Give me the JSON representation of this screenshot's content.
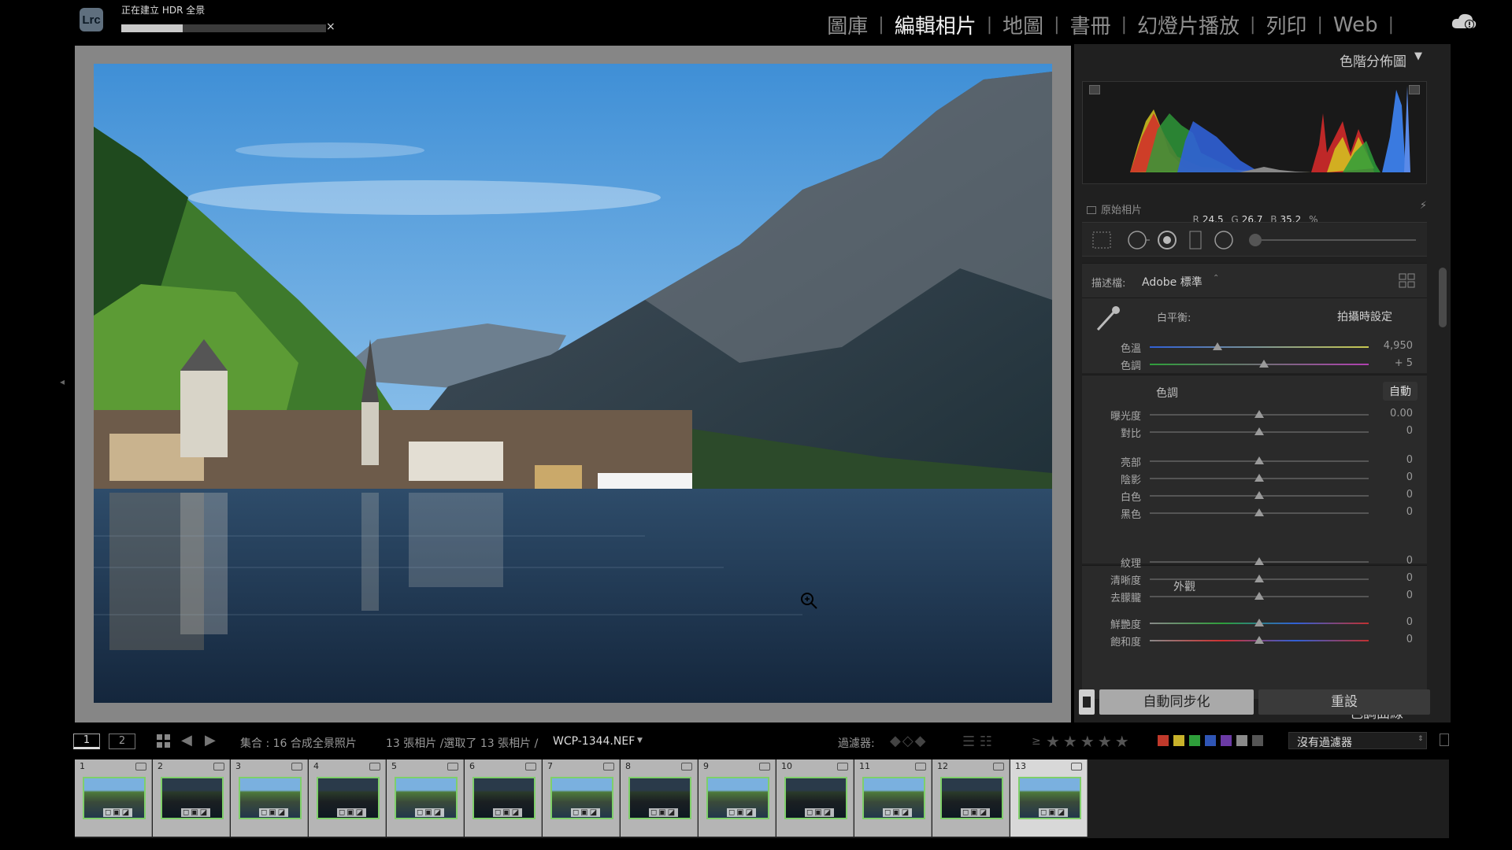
{
  "top": {
    "logo": "Lrc",
    "task_label": "正在建立 HDR 全景",
    "task_progress": 0.3,
    "task_close": "×",
    "modules": [
      {
        "label": "圖庫",
        "active": false
      },
      {
        "label": "編輯相片",
        "active": true
      },
      {
        "label": "地圖",
        "active": false
      },
      {
        "label": "書冊",
        "active": false
      },
      {
        "label": "幻燈片播放",
        "active": false
      },
      {
        "label": "列印",
        "active": false
      },
      {
        "label": "Web",
        "active": false
      }
    ],
    "separator": "|",
    "cloud_icon": "cloud-sync-icon"
  },
  "histogram": {
    "title": "色階分佈圖",
    "collapse": "▼",
    "r_label": "R",
    "r_value": "24.5",
    "g_label": "G",
    "g_value": "26.7",
    "b_label": "B",
    "b_value": "35.2",
    "percent": "%",
    "original_label": "原始相片"
  },
  "profile": {
    "label": "描述檔:",
    "value": "Adobe 標準",
    "arrow": "⌃"
  },
  "wb": {
    "label": "白平衡:",
    "value": "拍攝時設定",
    "temp_label": "色溫",
    "temp_value": "4,950",
    "temp_pos": 0.31,
    "tint_label": "色調",
    "tint_value": "+ 5",
    "tint_pos": 0.52
  },
  "tone": {
    "title": "色調",
    "auto": "自動",
    "sliders": [
      {
        "label": "曝光度",
        "value": "0.00",
        "pos": 0.5
      },
      {
        "label": "對比",
        "value": "0",
        "pos": 0.5
      },
      {
        "label": "亮部",
        "value": "0",
        "pos": 0.5
      },
      {
        "label": "陰影",
        "value": "0",
        "pos": 0.5
      },
      {
        "label": "白色",
        "value": "0",
        "pos": 0.5
      },
      {
        "label": "黑色",
        "value": "0",
        "pos": 0.5
      }
    ]
  },
  "presence": {
    "title": "外觀",
    "sliders": [
      {
        "label": "紋理",
        "value": "0",
        "pos": 0.5
      },
      {
        "label": "清晰度",
        "value": "0",
        "pos": 0.5
      },
      {
        "label": "去朦朧",
        "value": "0",
        "pos": 0.5
      },
      {
        "label": "鮮艷度",
        "value": "0",
        "pos": 0.5
      },
      {
        "label": "飽和度",
        "value": "0",
        "pos": 0.5
      }
    ]
  },
  "curve": {
    "title": "色調曲線",
    "collapse": "▼"
  },
  "buttons": {
    "sync": "自動同步化",
    "reset": "重設"
  },
  "bottom": {
    "view1": "1",
    "view2": "2",
    "collection": "集合 : 16 合成全景照片",
    "count": "13 張相片 /選取了 13 張相片 /",
    "filename": "WCP-1344.NEF",
    "filter_label": "過濾器:",
    "filter_ge": "≥",
    "stars": "★★★★★",
    "filter_value": "沒有過濾器"
  },
  "filmstrip": {
    "items": [
      "1",
      "2",
      "3",
      "4",
      "5",
      "6",
      "7",
      "8",
      "9",
      "10",
      "11",
      "12",
      "13"
    ],
    "selected": 13
  },
  "colors": {
    "accent_green": "#7fcf6a",
    "label_colors": [
      "#c0392b",
      "#c8b22a",
      "#2e9e3a",
      "#2f55b5",
      "#6b3aa5",
      "#8a8a8a",
      "#555555"
    ]
  }
}
